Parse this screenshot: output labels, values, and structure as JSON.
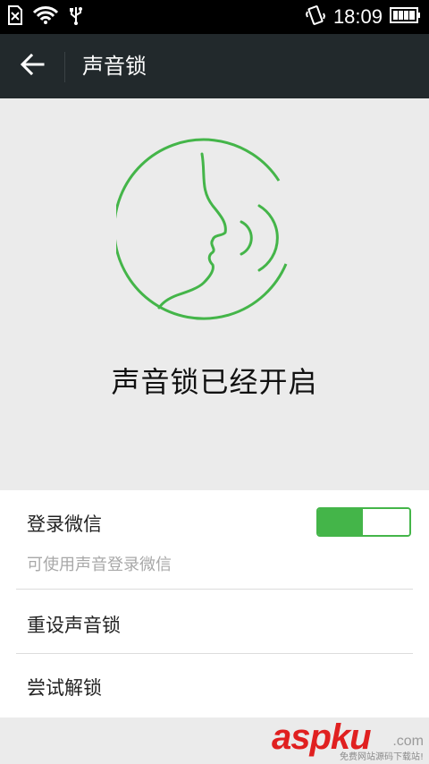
{
  "status_bar": {
    "time": "18:09"
  },
  "app_bar": {
    "title": "声音锁"
  },
  "hero": {
    "heading": "声音锁已经开启"
  },
  "settings": {
    "login": {
      "label": "登录微信",
      "subtitle": "可使用声音登录微信",
      "enabled": true
    },
    "reset_label": "重设声音锁",
    "try_label": "尝试解锁"
  },
  "watermark": {
    "main": "aspku",
    "suffix": ".com",
    "sub": "免费网站源码下载站!"
  },
  "colors": {
    "accent": "#44b549",
    "app_bar": "#22292c",
    "background": "#ebebeb"
  }
}
